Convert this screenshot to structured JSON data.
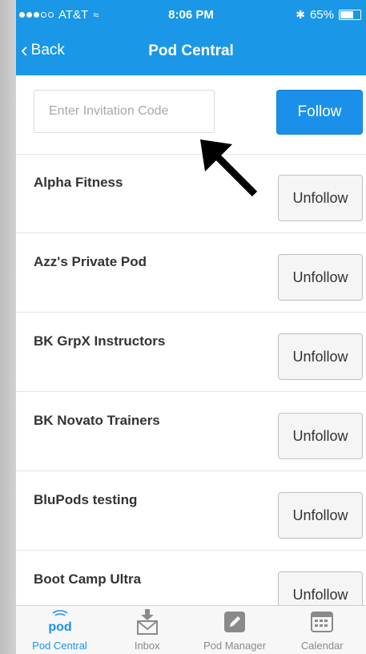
{
  "status_bar": {
    "carrier": "AT&T",
    "time": "8:06 PM",
    "battery_text": "65%",
    "battery_level": 0.65,
    "signal_bars": 3,
    "signal_total": 5
  },
  "nav": {
    "back_label": "Back",
    "title": "Pod Central"
  },
  "invite": {
    "placeholder": "Enter Invitation Code",
    "value": "",
    "follow_label": "Follow"
  },
  "pods": [
    {
      "name": "Alpha Fitness",
      "action": "Unfollow"
    },
    {
      "name": "Azz's Private Pod",
      "action": "Unfollow"
    },
    {
      "name": "BK GrpX Instructors",
      "action": "Unfollow"
    },
    {
      "name": "BK Novato Trainers",
      "action": "Unfollow"
    },
    {
      "name": "BluPods testing",
      "action": "Unfollow"
    },
    {
      "name": "Boot Camp Ultra",
      "action": "Unfollow"
    }
  ],
  "tabs": [
    {
      "label": "Pod Central",
      "icon": "pod-logo-icon",
      "active": true
    },
    {
      "label": "Inbox",
      "icon": "inbox-icon",
      "active": false
    },
    {
      "label": "Pod Manager",
      "icon": "edit-icon",
      "active": false
    },
    {
      "label": "Calendar",
      "icon": "calendar-icon",
      "active": false
    }
  ],
  "colors": {
    "primary": "#1a97e6",
    "tab_active": "#1a90ea",
    "tab_inactive": "#8a8a8a"
  }
}
